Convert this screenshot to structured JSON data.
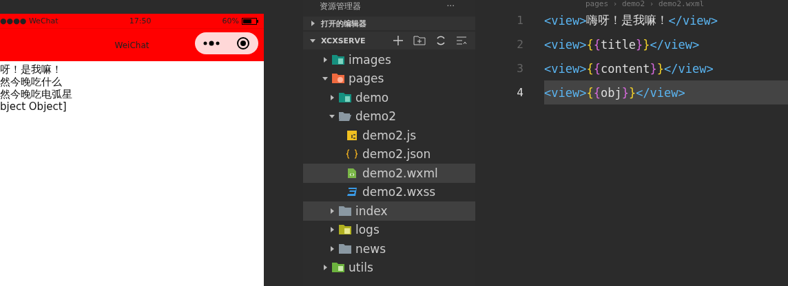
{
  "simulator": {
    "status_bar": {
      "signal": "●●●● WeChat",
      "time": "17:50",
      "battery": "60%"
    },
    "nav_title": "WeiChat",
    "lines": [
      "呀！是我嘛！",
      "然今晚吃什么",
      "然今晚吃电弧星",
      "bject Object]"
    ]
  },
  "explorer": {
    "title": "资源管理器",
    "more": "···",
    "sections": [
      {
        "label": "打开的编辑器",
        "expanded": false
      },
      {
        "label": "XCXSERVE",
        "expanded": true
      }
    ],
    "tree": [
      {
        "name": "images",
        "kind": "folder-images",
        "expanded": false,
        "selected": false
      },
      {
        "name": "pages",
        "kind": "folder-pages",
        "expanded": true,
        "selected": false,
        "children": [
          {
            "name": "demo",
            "kind": "folder-images",
            "expanded": false,
            "selected": false
          },
          {
            "name": "demo2",
            "kind": "folder-open",
            "expanded": true,
            "selected": false,
            "children": [
              {
                "name": "demo2.js",
                "kind": "js",
                "selected": false
              },
              {
                "name": "demo2.json",
                "kind": "json",
                "selected": false
              },
              {
                "name": "demo2.wxml",
                "kind": "wxml",
                "selected": true
              },
              {
                "name": "demo2.wxss",
                "kind": "wxss",
                "selected": false
              }
            ]
          },
          {
            "name": "index",
            "kind": "folder",
            "expanded": false,
            "selected": true
          },
          {
            "name": "logs",
            "kind": "folder-logs",
            "expanded": false,
            "selected": false
          },
          {
            "name": "news",
            "kind": "folder",
            "expanded": false,
            "selected": false
          }
        ]
      },
      {
        "name": "utils",
        "kind": "folder-utils",
        "expanded": false,
        "selected": false
      }
    ]
  },
  "editor": {
    "breadcrumb": "pages › demo2 › demo2.wxml",
    "lines": [
      {
        "number": "1",
        "current": false,
        "tokens": [
          {
            "kind": "tag",
            "text": "<view>"
          },
          {
            "kind": "text",
            "text": "嗨呀！是我嘛！"
          },
          {
            "kind": "tag",
            "text": "</view>"
          }
        ]
      },
      {
        "number": "2",
        "current": false,
        "tokens": [
          {
            "kind": "tag",
            "text": "<view>"
          },
          {
            "kind": "brace1",
            "text": "{"
          },
          {
            "kind": "brace2",
            "text": "{"
          },
          {
            "kind": "text",
            "text": "title"
          },
          {
            "kind": "brace2",
            "text": "}"
          },
          {
            "kind": "brace1",
            "text": "}"
          },
          {
            "kind": "tag",
            "text": "</view>"
          }
        ]
      },
      {
        "number": "3",
        "current": false,
        "tokens": [
          {
            "kind": "tag",
            "text": "<view>"
          },
          {
            "kind": "brace1",
            "text": "{"
          },
          {
            "kind": "brace2",
            "text": "{"
          },
          {
            "kind": "text",
            "text": "content"
          },
          {
            "kind": "brace2",
            "text": "}"
          },
          {
            "kind": "brace1",
            "text": "}"
          },
          {
            "kind": "tag",
            "text": "</view>"
          }
        ]
      },
      {
        "number": "4",
        "current": true,
        "tokens": [
          {
            "kind": "tag",
            "text": "<view>"
          },
          {
            "kind": "brace1",
            "text": "{"
          },
          {
            "kind": "brace2",
            "text": "{"
          },
          {
            "kind": "text",
            "text": "obj"
          },
          {
            "kind": "brace2",
            "text": "}"
          },
          {
            "kind": "brace1",
            "text": "}"
          },
          {
            "kind": "tag",
            "text": "</view>"
          }
        ]
      }
    ]
  }
}
